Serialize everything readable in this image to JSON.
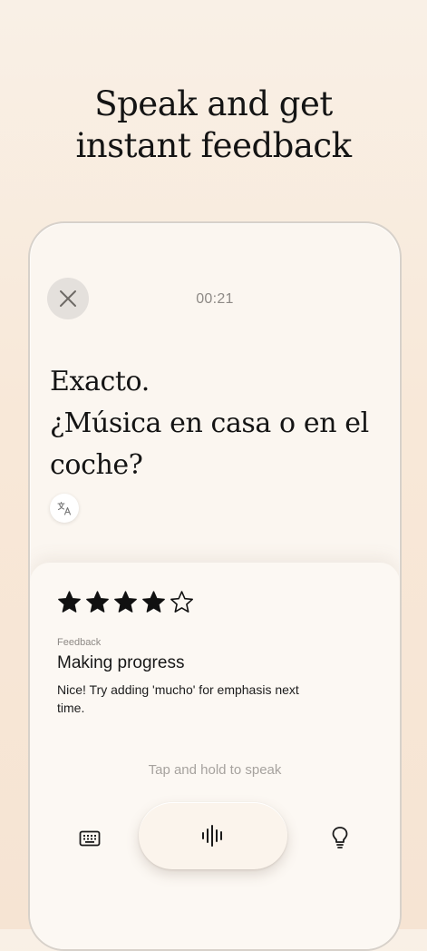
{
  "headline": {
    "line1": "Speak and get",
    "line2": "instant feedback"
  },
  "session": {
    "timer": "00:21",
    "prompt_line1": "Exacto.",
    "prompt_line2": "¿Música en casa o en el",
    "prompt_line3": "coche?"
  },
  "feedback": {
    "rating": 4,
    "max_rating": 5,
    "label": "Feedback",
    "title": "Making progress",
    "text": "Nice! Try adding 'mucho' for emphasis next time."
  },
  "controls": {
    "hint": "Tap and hold to speak"
  },
  "icons": {
    "close": "close-icon",
    "translate": "translate-icon",
    "keyboard": "keyboard-icon",
    "mic": "waveform-icon",
    "lightbulb": "lightbulb-icon"
  },
  "colors": {
    "background": "#f8e8d8",
    "card": "#fbf6f0",
    "star": "#111111"
  }
}
